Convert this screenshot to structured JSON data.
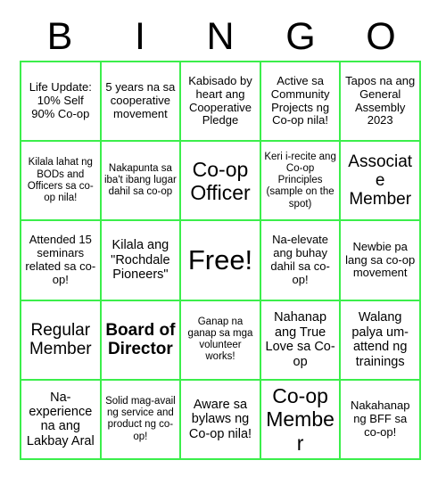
{
  "card": {
    "title": "Bingo Card",
    "grid_border_color": "#3bee4b",
    "text_color": "#000000",
    "background_color": "#ffffff",
    "columns": 5,
    "rows": 5
  },
  "header": {
    "letters": [
      "B",
      "I",
      "N",
      "G",
      "O"
    ]
  },
  "cells": [
    {
      "row": 1,
      "col": 1,
      "column_letter": "B",
      "text": "Life Update: 10% Self 90% Co-op",
      "size": "sm",
      "bold": false,
      "free_space": false
    },
    {
      "row": 1,
      "col": 2,
      "column_letter": "I",
      "text": "5 years na sa cooperative movement",
      "size": "sm",
      "bold": false,
      "free_space": false
    },
    {
      "row": 1,
      "col": 3,
      "column_letter": "N",
      "text": "Kabisado by heart ang Cooperative Pledge",
      "size": "sm",
      "bold": false,
      "free_space": false
    },
    {
      "row": 1,
      "col": 4,
      "column_letter": "G",
      "text": "Active sa Community Projects ng Co-op nila!",
      "size": "sm",
      "bold": false,
      "free_space": false
    },
    {
      "row": 1,
      "col": 5,
      "column_letter": "O",
      "text": "Tapos na ang General Assembly 2023",
      "size": "sm",
      "bold": false,
      "free_space": false
    },
    {
      "row": 2,
      "col": 1,
      "column_letter": "B",
      "text": "Kilala lahat ng BODs and Officers sa co-op nila!",
      "size": "xs",
      "bold": false,
      "free_space": false
    },
    {
      "row": 2,
      "col": 2,
      "column_letter": "I",
      "text": "Nakapunta sa iba't ibang lugar dahil sa co-op",
      "size": "xs",
      "bold": false,
      "free_space": false
    },
    {
      "row": 2,
      "col": 3,
      "column_letter": "N",
      "text": "Co-op Officer",
      "size": "xl",
      "bold": false,
      "free_space": false
    },
    {
      "row": 2,
      "col": 4,
      "column_letter": "G",
      "text": "Keri i-recite ang Co-op Principles (sample on the spot)",
      "size": "xs",
      "bold": false,
      "free_space": false
    },
    {
      "row": 2,
      "col": 5,
      "column_letter": "O",
      "text": "Associate Member",
      "size": "lg",
      "bold": false,
      "free_space": false
    },
    {
      "row": 3,
      "col": 1,
      "column_letter": "B",
      "text": "Attended 15 seminars related sa co-op!",
      "size": "sm",
      "bold": false,
      "free_space": false
    },
    {
      "row": 3,
      "col": 2,
      "column_letter": "I",
      "text": "Kilala ang \"Rochdale Pioneers\"",
      "size": "md",
      "bold": false,
      "free_space": false
    },
    {
      "row": 3,
      "col": 3,
      "column_letter": "N",
      "text": "Free!",
      "size": "xxl",
      "bold": false,
      "free_space": true
    },
    {
      "row": 3,
      "col": 4,
      "column_letter": "G",
      "text": "Na-elevate ang buhay dahil sa co-op!",
      "size": "sm",
      "bold": false,
      "free_space": false
    },
    {
      "row": 3,
      "col": 5,
      "column_letter": "O",
      "text": "Newbie pa lang sa co-op movement",
      "size": "sm",
      "bold": false,
      "free_space": false
    },
    {
      "row": 4,
      "col": 1,
      "column_letter": "B",
      "text": "Regular Member",
      "size": "lg",
      "bold": false,
      "free_space": false
    },
    {
      "row": 4,
      "col": 2,
      "column_letter": "I",
      "text": "Board of Director",
      "size": "lg",
      "bold": true,
      "free_space": false
    },
    {
      "row": 4,
      "col": 3,
      "column_letter": "N",
      "text": "Ganap na ganap sa mga volunteer works!",
      "size": "xs",
      "bold": false,
      "free_space": false
    },
    {
      "row": 4,
      "col": 4,
      "column_letter": "G",
      "text": "Nahanap ang True Love sa Co-op",
      "size": "md",
      "bold": false,
      "free_space": false
    },
    {
      "row": 4,
      "col": 5,
      "column_letter": "O",
      "text": "Walang palya um-attend ng trainings",
      "size": "md",
      "bold": false,
      "free_space": false
    },
    {
      "row": 5,
      "col": 1,
      "column_letter": "B",
      "text": "Na-experience na ang Lakbay Aral",
      "size": "md",
      "bold": false,
      "free_space": false
    },
    {
      "row": 5,
      "col": 2,
      "column_letter": "I",
      "text": "Solid mag-avail ng service and product ng co-op!",
      "size": "xs",
      "bold": false,
      "free_space": false
    },
    {
      "row": 5,
      "col": 3,
      "column_letter": "N",
      "text": "Aware sa bylaws ng Co-op nila!",
      "size": "md",
      "bold": false,
      "free_space": false
    },
    {
      "row": 5,
      "col": 4,
      "column_letter": "G",
      "text": "Co-op Member",
      "size": "xl",
      "bold": false,
      "free_space": false
    },
    {
      "row": 5,
      "col": 5,
      "column_letter": "O",
      "text": "Nakahanap ng BFF sa co-op!",
      "size": "sm",
      "bold": false,
      "free_space": false
    }
  ]
}
